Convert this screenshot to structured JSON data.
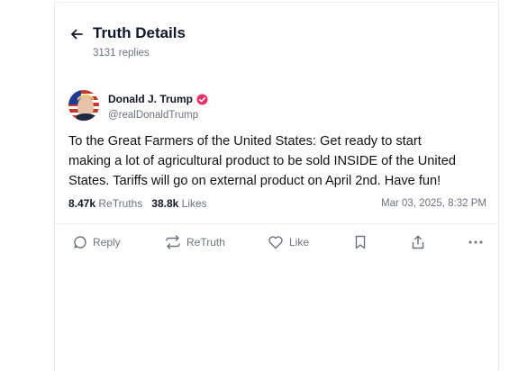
{
  "header": {
    "title": "Truth Details",
    "replies": "3131 replies"
  },
  "post": {
    "author_name": "Donald J. Trump",
    "handle": "@realDonaldTrump",
    "text_lines": [
      "To the Great Farmers of the United States: Get ready to start",
      "making a lot of agricultural product to be sold INSIDE of the United",
      "States. Tariffs will go on external product on April 2nd. Have fun!"
    ],
    "retruths_count": "8.47k",
    "retruths_label": "ReTruths",
    "likes_count": "38.8k",
    "likes_label": "Likes",
    "timestamp": "Mar 03, 2025, 8:32 PM"
  },
  "actions": {
    "reply": "Reply",
    "retruth": "ReTruth",
    "like": "Like"
  },
  "icons": [
    "back-arrow-icon",
    "verified-badge-icon",
    "reply-icon",
    "retruth-icon",
    "heart-icon",
    "bookmark-icon",
    "share-icon",
    "more-icon"
  ],
  "colors": {
    "verified": "#e8336b",
    "muted_text": "#6b7280",
    "text": "#111111"
  }
}
